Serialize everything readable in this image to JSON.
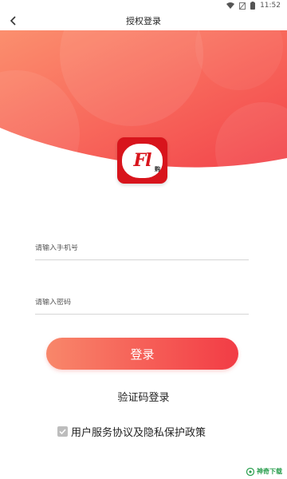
{
  "status_bar": {
    "time": "11:52",
    "icons": [
      "wifi-icon",
      "sim-icon",
      "battery-icon"
    ]
  },
  "app_bar": {
    "back_icon": "back-arrow-icon",
    "title": "授权登录"
  },
  "logo": {
    "text": "Fl",
    "sub": "购"
  },
  "form": {
    "phone_placeholder": "请输入手机号",
    "phone_value": "",
    "password_placeholder": "请输入密码",
    "password_value": ""
  },
  "login_button": "登录",
  "code_login_link": "验证码登录",
  "agreement": {
    "checked": true,
    "text": "用户服务协议及隐私保护政策"
  },
  "watermark": {
    "text": "神奇下载"
  },
  "colors": {
    "accent_start": "#f8876a",
    "accent_end": "#f23c45",
    "logo_red": "#d8141c"
  }
}
